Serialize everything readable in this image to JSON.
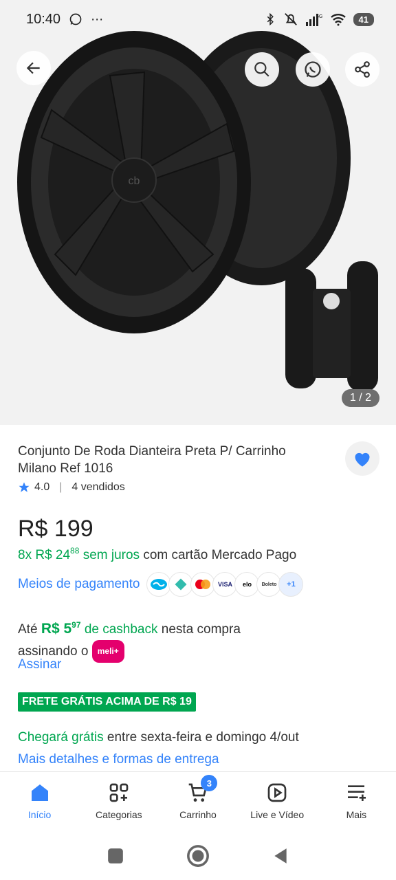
{
  "status_bar": {
    "time": "10:40",
    "battery": "41"
  },
  "gallery": {
    "counter": "1 / 2"
  },
  "product": {
    "title": "Conjunto De Roda Dianteira Preta P/ Carrinho Milano Ref 1016",
    "rating": "4.0",
    "sold": "4 vendidos",
    "price": "R$ 199",
    "installments": {
      "prefix": "8x R$ 24",
      "cents": "88",
      "no_interest": "sem juros",
      "suffix": "com cartão Mercado Pago"
    },
    "payment_methods_link": "Meios de pagamento",
    "payment_icons": [
      "VISA",
      "elo",
      "Boleto",
      "+1"
    ],
    "cashback": {
      "prefix": "Até",
      "amount": "R$ 5",
      "cents": "97",
      "label": "de cashback",
      "suffix": "nesta compra",
      "line2": "assinando o",
      "meli": "meli+"
    },
    "subscribe_link": "Assinar",
    "shipping_badge": "FRETE GRÁTIS ACIMA DE R$ 19",
    "delivery": {
      "highlight": "Chegará grátis",
      "text": "entre sexta-feira e domingo 4/out"
    },
    "delivery_link": "Mais detalhes e formas de entrega"
  },
  "bottom_nav": {
    "items": [
      {
        "label": "Início"
      },
      {
        "label": "Categorias"
      },
      {
        "label": "Carrinho",
        "badge": "3"
      },
      {
        "label": "Live e Vídeo"
      },
      {
        "label": "Mais"
      }
    ]
  },
  "colors": {
    "accent": "#3483fa",
    "green": "#00a650",
    "meli": "#e4006d"
  }
}
